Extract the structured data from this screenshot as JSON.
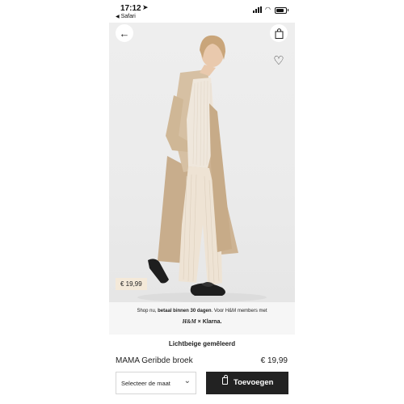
{
  "status_bar": {
    "time": "17:12",
    "back_app": "Safari"
  },
  "product": {
    "image_price": "€ 19,99",
    "color_name": "Lichtbeige gemêleerd",
    "name": "MAMA Geribde broek",
    "price": "€ 19,99"
  },
  "klarna": {
    "text_pre": "Shop nu, ",
    "text_bold": "betaal binnen 30 dagen",
    "text_post": ". Voor H&M members met",
    "hm_logo": "H&M",
    "times": "×",
    "klarna_logo": "Klarna."
  },
  "actions": {
    "size_select_label": "Selecteer de maat",
    "add_label": "Toevoegen"
  },
  "icons": {
    "back": "arrow-left-icon",
    "bag": "shopping-bag-icon",
    "favorite": "heart-icon",
    "location": "location-arrow-icon",
    "chevron": "chevron-down-icon"
  },
  "colors": {
    "price_tag_bg": "#f4e9d9",
    "button_dark": "#222222",
    "klarna_bg": "#f6f6f6"
  }
}
